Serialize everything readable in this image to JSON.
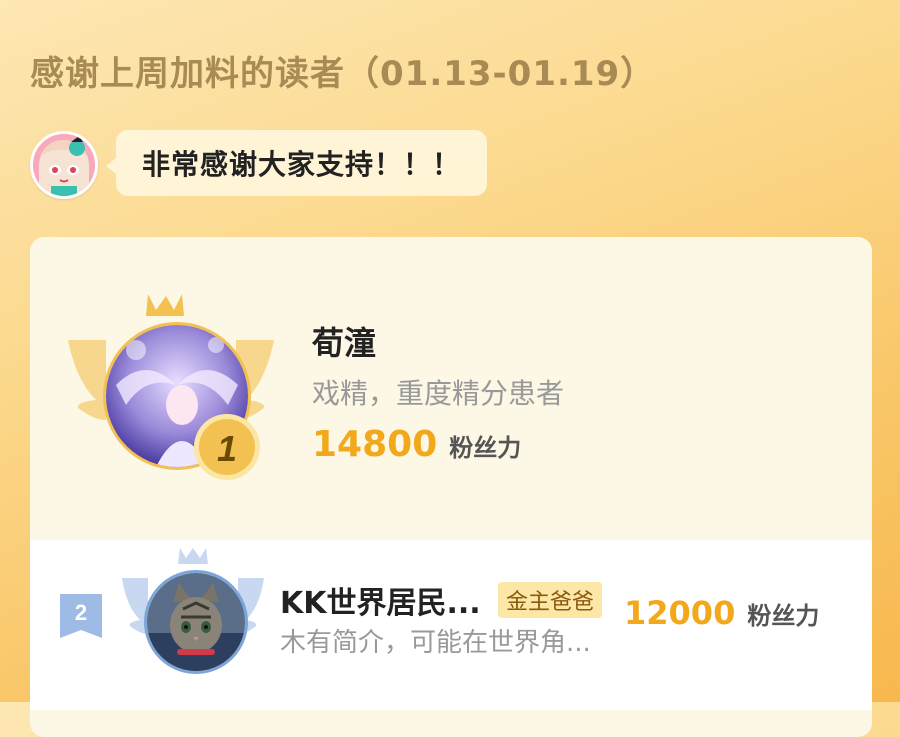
{
  "header": {
    "title": "感谢上周加料的读者（01.13-01.19）"
  },
  "host": {
    "avatar_icon": "anime-girl-avatar-icon",
    "message": "非常感谢大家支持！！！"
  },
  "leaderboard": [
    {
      "rank": "1",
      "name": "荀潼",
      "bio": "戏精，重度精分患者",
      "score": "14800",
      "score_label": "粉丝力",
      "avatar_icon": "purple-angel-avatar-icon"
    },
    {
      "rank": "2",
      "name": "KK世界居民...",
      "tag": "金主爸爸",
      "bio": "木有简介，可能在世界角...",
      "score": "12000",
      "score_label": "粉丝力",
      "avatar_icon": "cat-avatar-icon"
    }
  ],
  "colors": {
    "gold": "#f2a81b",
    "silver": "#7da5d8",
    "card_bg": "#fdf7e6"
  }
}
